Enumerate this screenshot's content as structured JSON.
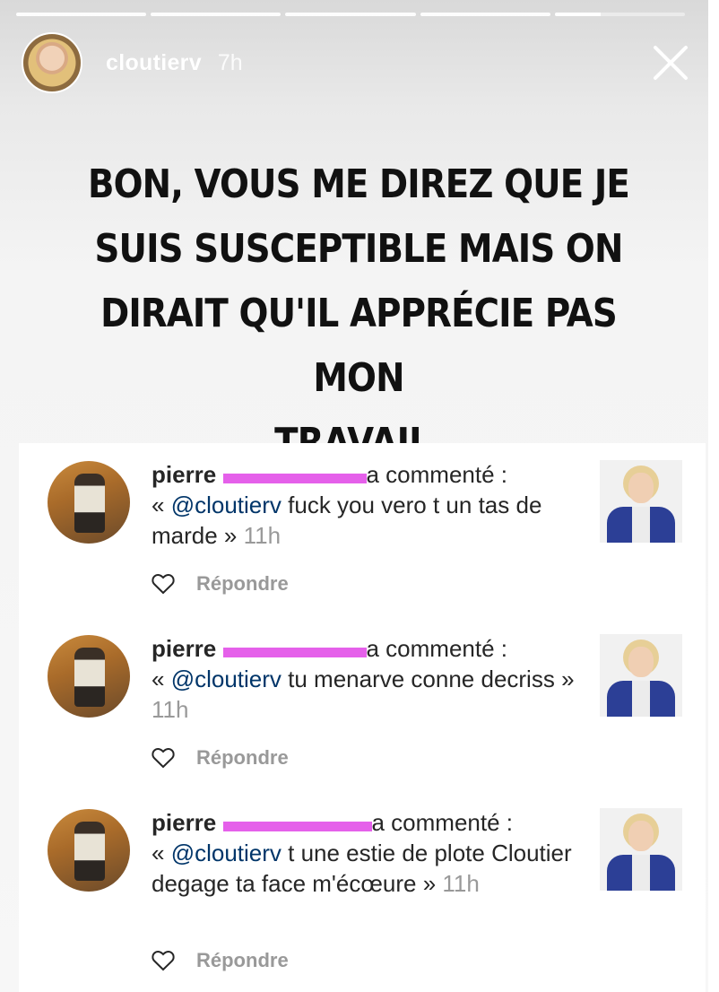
{
  "story": {
    "progress_segments": [
      1,
      1,
      1,
      1,
      0.35
    ],
    "username": "cloutierv",
    "time_ago": "7h",
    "text_lines": [
      "BON, VOUS ME DIREZ QUE JE",
      "SUIS SUSCEPTIBLE MAIS ON",
      "DIRAIT QU'IL APPRÉCIE PAS MON",
      "TRAVAIL."
    ]
  },
  "comments": [
    {
      "user_prefix": "pierre",
      "action": " a commenté :",
      "open_quote": "« ",
      "mention": "@cloutierv",
      "body": " fuck you vero t un tas de marde",
      "close_quote": " » ",
      "time_ago": "11h",
      "reply_label": "Répondre"
    },
    {
      "user_prefix": "pierre",
      "action": " a commenté :",
      "open_quote": "« ",
      "mention": "@cloutierv",
      "body": " tu menarve conne decriss",
      "close_quote": " » ",
      "time_ago": "11h",
      "reply_label": "Répondre"
    },
    {
      "user_prefix": "pierre",
      "action": " a commenté :",
      "open_quote": "« ",
      "mention": "@cloutierv",
      "body": " t une estie de plote Cloutier degage ta face m'écœure",
      "close_quote": " » ",
      "time_ago": "11h",
      "reply_label": "Répondre"
    }
  ],
  "colors": {
    "redaction": "#e560ea",
    "mention": "#003569",
    "meta_gray": "#999999"
  },
  "icons": {
    "close": "close-icon",
    "like": "heart-icon"
  }
}
